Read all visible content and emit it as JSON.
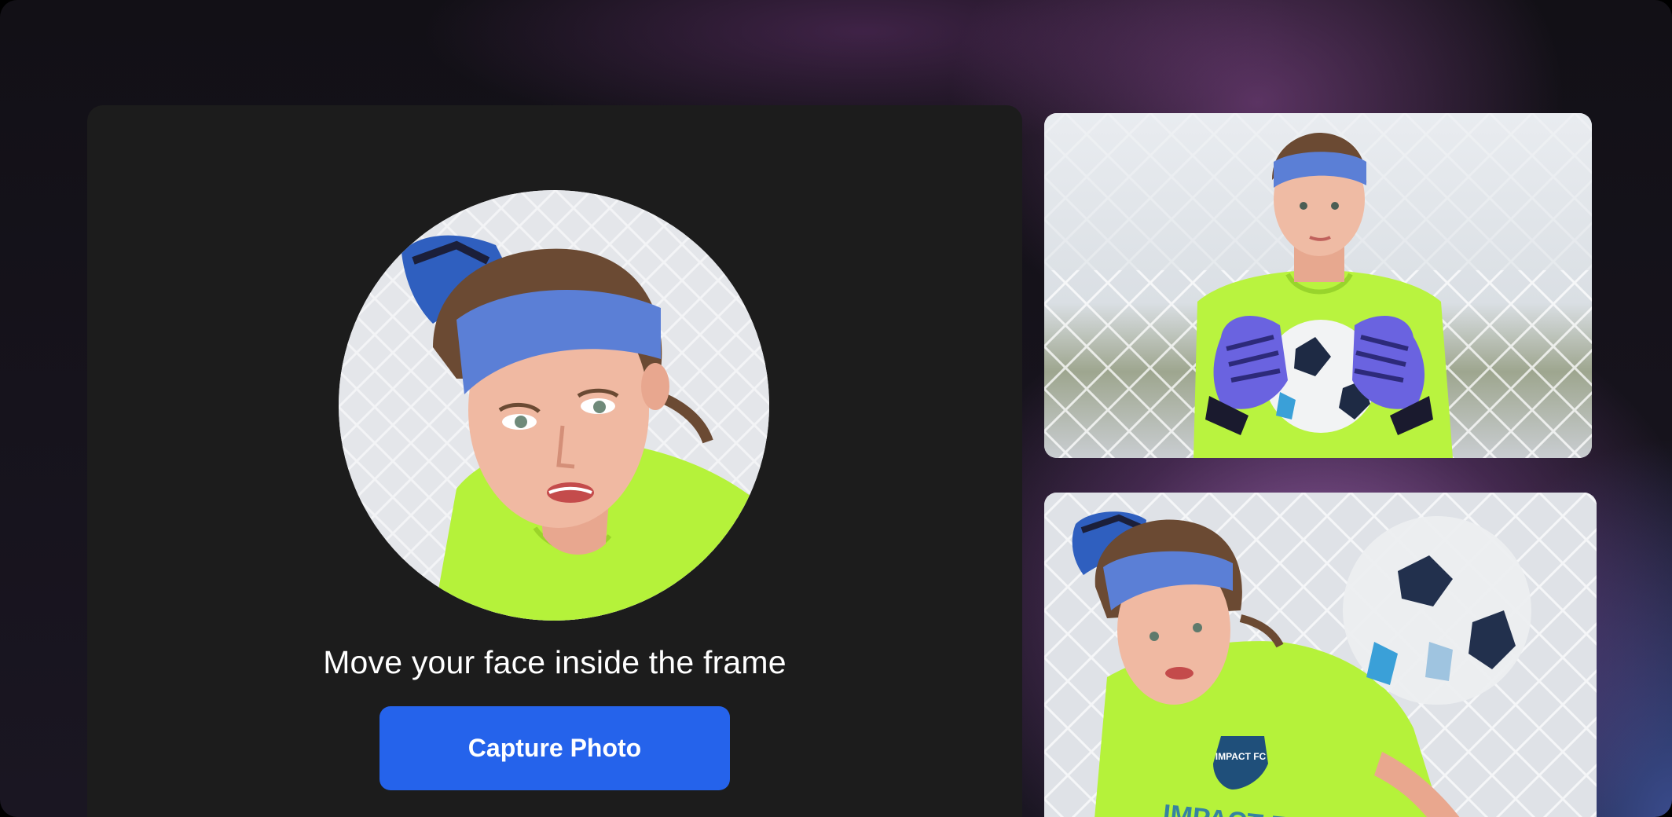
{
  "camera": {
    "instruction": "Move your face inside the frame",
    "capture_label": "Capture Photo"
  },
  "gallery": {
    "photos": [
      {
        "subject": "goalkeeper holding soccer ball"
      },
      {
        "subject": "goalkeeper diving toward soccer ball"
      }
    ],
    "crest_text": "IMPACT FC",
    "jersey_text": "IMPACT FC"
  },
  "colors": {
    "accent": "#2563eb",
    "card": "#1c1c1c",
    "jersey": "#b5f23a",
    "headband": "#5b7fd6"
  }
}
